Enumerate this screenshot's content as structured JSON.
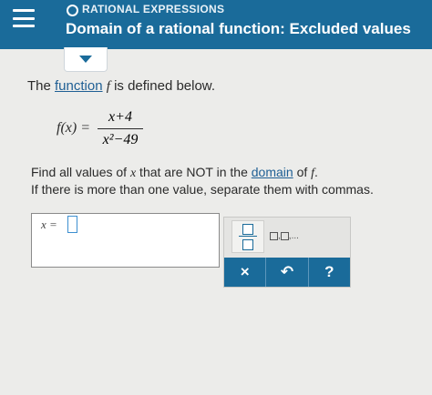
{
  "header": {
    "section_label": "RATIONAL EXPRESSIONS",
    "title": "Domain of a rational function: Excluded values"
  },
  "problem": {
    "intro_prefix": "The ",
    "intro_link": "function",
    "intro_var": "f",
    "intro_suffix": " is defined below.",
    "function_lhs": "f(x) = ",
    "numerator": "x+4",
    "denominator": "x²−49",
    "question_line1_prefix": "Find all values of ",
    "question_line1_var": "x",
    "question_line1_mid": " that are NOT in the ",
    "question_line1_link": "domain",
    "question_line1_suffix": " of ",
    "question_line1_var2": "f",
    "question_line1_end": ".",
    "question_line2": "If there is more than one value, separate them with commas."
  },
  "answer": {
    "label": "x = ",
    "value": ""
  },
  "keypad": {
    "list_label_sep": ",",
    "list_label_ellipsis": "...",
    "clear_label": "×",
    "undo_label": "↶",
    "help_label": "?"
  },
  "colors": {
    "header_bg": "#1a6b9a",
    "link": "#1f5f94",
    "button_bg": "#1a6b9a"
  }
}
